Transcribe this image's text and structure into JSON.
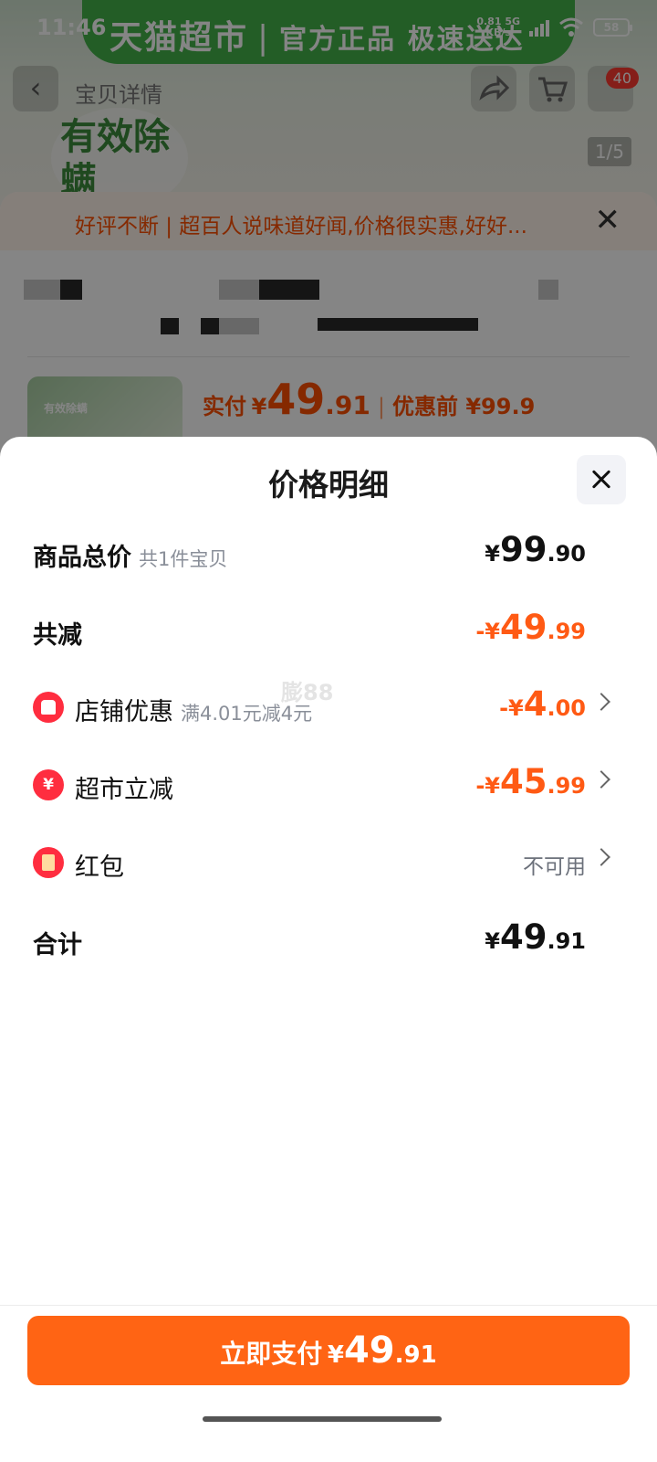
{
  "status_bar": {
    "time": "11:46",
    "net_speed_value": "0.81",
    "net_speed_unit": "KB/s",
    "network": "5G",
    "battery": "58"
  },
  "background": {
    "banner_brand": "天猫超市",
    "banner_separator": "|",
    "banner_slogan": "官方正品 极速送达",
    "nav_title": "宝贝详情",
    "cart_badge": "40",
    "image_counter": "1/5",
    "hero_stamp": "有效除螨",
    "review_text": "好评不断 | 超百人说味道好闻,价格很实惠,好好...",
    "thumb_text": "有效除螨",
    "price_label": "实付",
    "price_yen": "¥",
    "price_int": "49",
    "price_dec": ".91",
    "price_separator": "|",
    "original_price": "优惠前 ¥99.9"
  },
  "sheet": {
    "title": "价格明细",
    "watermark": "膨88",
    "rows": {
      "total_price": {
        "label": "商品总价",
        "sub": "共1件宝贝",
        "yen": "¥",
        "int": "99",
        "dec": ".90"
      },
      "total_discount": {
        "label": "共减",
        "prefix": "-",
        "yen": "¥",
        "int": "49",
        "dec": ".99"
      },
      "shop_discount": {
        "icon": "shop-icon",
        "label": "店铺优惠",
        "sub": "满4.01元减4元",
        "prefix": "-",
        "yen": "¥",
        "int": "4",
        "dec": ".00"
      },
      "market_discount": {
        "icon": "yen-refresh-icon",
        "label": "超市立减",
        "prefix": "-",
        "yen": "¥",
        "int": "45",
        "dec": ".99"
      },
      "red_packet": {
        "icon": "red-packet-icon",
        "label": "红包",
        "status": "不可用"
      },
      "grand_total": {
        "label": "合计",
        "yen": "¥",
        "int": "49",
        "dec": ".91"
      }
    },
    "pay_button": {
      "label": "立即支付",
      "yen": "¥",
      "int": "49",
      "dec": ".91"
    }
  },
  "colors": {
    "accent_orange": "#ff6414",
    "discount_orange": "#ff5a14",
    "icon_red": "#ff2d3f",
    "banner_green": "#43b34a"
  }
}
